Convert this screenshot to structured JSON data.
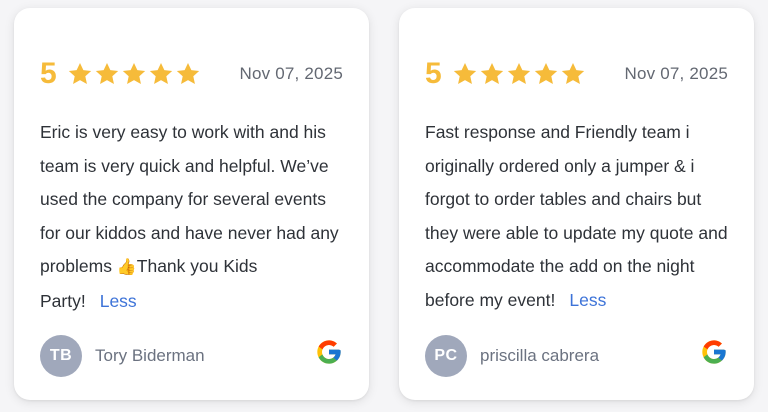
{
  "colors": {
    "rating": "#f6bb3a",
    "star": "#f6bb3a",
    "link": "#3d73d8",
    "avatar_bg": "#a0a8bb",
    "text": "#2e3238",
    "muted": "#636872"
  },
  "reviews": [
    {
      "rating": "5",
      "stars": 5,
      "date": "Nov 07, 2025",
      "text": "Eric is very easy to work with and his team is very quick and helpful. We’ve used the company for several events for our kiddos and have never had any problems ",
      "thumb_emoji": "👍",
      "text_after": "Thank you Kids Party!",
      "less_label": "Less",
      "initials": "TB",
      "author": "Tory Biderman",
      "source_icon": "google-icon"
    },
    {
      "rating": "5",
      "stars": 5,
      "date": "Nov 07, 2025",
      "text": "Fast response and Friendly team i originally ordered only a jumper & i forgot to order tables and chairs but they were able to update my quote and accommodate the add on the night before my event!",
      "thumb_emoji": "",
      "text_after": "",
      "less_label": "Less",
      "initials": "PC",
      "author": "priscilla cabrera",
      "source_icon": "google-icon"
    }
  ]
}
